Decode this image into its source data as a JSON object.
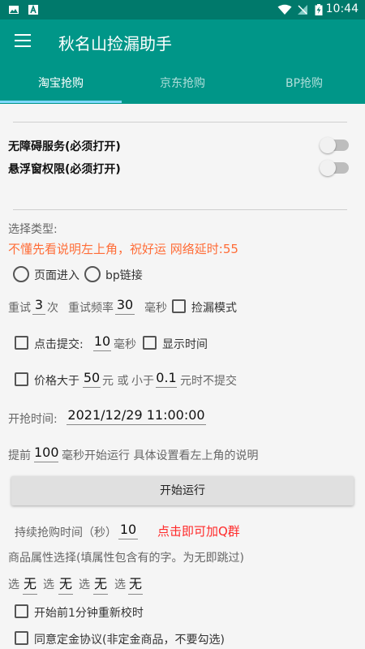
{
  "statusbar": {
    "time": "10:44"
  },
  "appbar": {
    "title": "秋名山捡漏助手"
  },
  "tabs": [
    {
      "label": "淘宝抢购"
    },
    {
      "label": "京东抢购"
    },
    {
      "label": "BP抢购"
    }
  ],
  "permissions": {
    "accessibility": "无障碍服务(必须打开)",
    "overlay": "悬浮窗权限(必须打开)"
  },
  "type_section": {
    "label": "选择类型:",
    "warning": "不懂先看说明左上角，祝好运 网络延时:55",
    "option_page": "页面进入",
    "option_bp": "bp链接"
  },
  "retry": {
    "label": "重试",
    "count": "3",
    "count_unit": "次",
    "freq_label": "重试频率",
    "freq": "30",
    "freq_unit": "毫秒",
    "leak_mode": "捡漏模式"
  },
  "submit": {
    "label": "点击提交:",
    "delay": "10",
    "unit": "毫秒",
    "show_time": "显示时间"
  },
  "price": {
    "label": "价格大于",
    "min": "50",
    "or_text": "元 或",
    "less_label": "小于",
    "max": "0.1",
    "suffix": "元时不提交"
  },
  "start_time": {
    "label": "开抢时间:",
    "value": "2021/12/29 11:00:00"
  },
  "advance": {
    "label": "提前",
    "value": "100",
    "suffix": "毫秒开始运行 具体设置看左上角的说明"
  },
  "run_button": "开始运行",
  "duration": {
    "label": "持续抢购时间（秒）",
    "value": "10",
    "qq_link": "点击即可加Q群"
  },
  "attributes": {
    "label": "商品属性选择(填属性包含有的字。为无即跳过)",
    "prefix": "选",
    "values": [
      "无",
      "无",
      "无",
      "无"
    ]
  },
  "options": {
    "recalibrate": "开始前1分钟重新校时",
    "deposit": "同意定金协议(非定金商品，不要勾选)"
  },
  "colors": {
    "primary": "#009688",
    "primary_dark": "#00796b",
    "accent": "#80d8ff",
    "warning": "#ff6d38",
    "link_red": "#ff2a2a"
  }
}
